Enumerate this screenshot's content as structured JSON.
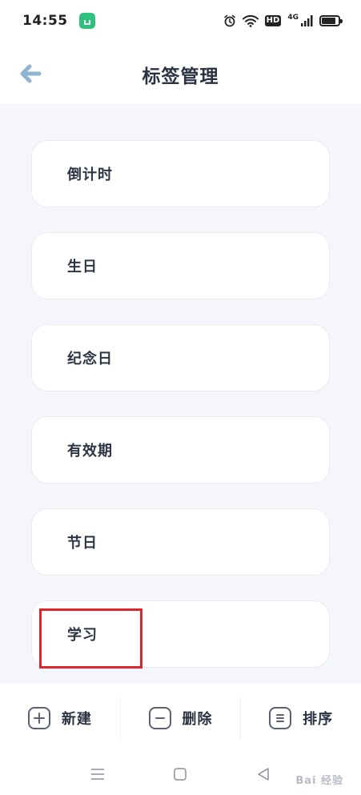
{
  "status_bar": {
    "time": "14:55",
    "hd": "HD",
    "network": "4G",
    "icons": [
      "app-badge-icon",
      "alarm-icon",
      "wifi-icon",
      "signal-icon",
      "battery-icon"
    ]
  },
  "header": {
    "title": "标签管理",
    "back_icon": "arrow-left-icon",
    "back_color": "#8fb4cf"
  },
  "tags": [
    {
      "label": "倒计时"
    },
    {
      "label": "生日"
    },
    {
      "label": "纪念日"
    },
    {
      "label": "有效期"
    },
    {
      "label": "节日"
    },
    {
      "label": "学习"
    }
  ],
  "actions": {
    "new_label": "新建",
    "delete_label": "删除",
    "sort_label": "排序"
  },
  "watermark": "Bai 经验",
  "colors": {
    "background": "#f4f6fb",
    "highlight": "#e0242b",
    "text": "#2d3443"
  }
}
